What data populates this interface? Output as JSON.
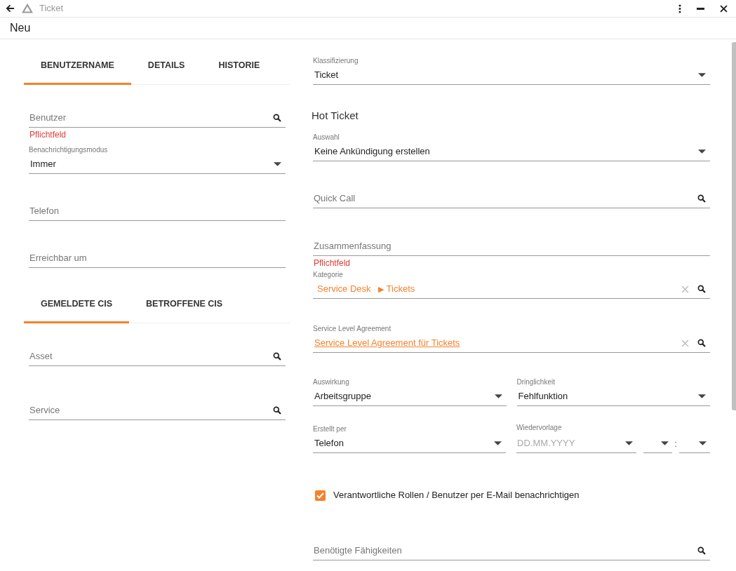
{
  "app_bar": {
    "title": "Ticket"
  },
  "page_title": "Neu",
  "left": [
    {
      "kind": "tabs",
      "tabs": [
        {
          "label": "BENUTZERNAME",
          "selected": true
        },
        {
          "label": "DETAILS",
          "selected": false
        },
        {
          "label": "HISTORIE",
          "selected": false
        }
      ]
    },
    {
      "kind": "search",
      "placeholder": "Benutzer",
      "error": "Pflichtfeld"
    },
    {
      "kind": "select",
      "label": "Benachrichtigungsmodus",
      "value": "Immer"
    },
    {
      "kind": "text",
      "placeholder": "Telefon"
    },
    {
      "kind": "text",
      "placeholder": "Erreichbar um"
    },
    {
      "kind": "tabs",
      "tabs": [
        {
          "label": "GEMELDETE CIS",
          "selected": true
        },
        {
          "label": "BETROFFENE CIS",
          "selected": false
        }
      ]
    },
    {
      "kind": "search",
      "placeholder": "Asset"
    },
    {
      "kind": "search",
      "placeholder": "Service"
    }
  ],
  "right": [
    {
      "kind": "select",
      "label": "Klassifizierung",
      "value": "Ticket"
    },
    {
      "kind": "heading",
      "text": "Hot Ticket"
    },
    {
      "kind": "select",
      "label": "Auswahl",
      "value": "Keine Ankündigung erstellen"
    },
    {
      "kind": "search",
      "placeholder": "Quick Call"
    },
    {
      "kind": "text",
      "placeholder": "Zusammenfassung",
      "error": "Pflichtfeld"
    },
    {
      "kind": "search",
      "label": "Kategorie",
      "path": [
        "Service Desk",
        "Tickets"
      ],
      "separator": "▶",
      "clearable": true
    },
    {
      "kind": "search",
      "label": "Service Level Agreement",
      "link": "Service Level Agreement für Tickets",
      "clearable": true
    },
    {
      "kind": "pair",
      "fields": [
        {
          "kind": "select",
          "label": "Auswirkung",
          "value": "Arbeitsgruppe"
        },
        {
          "kind": "select",
          "label": "Dringlichkeit",
          "value": "Fehlfunktion"
        }
      ]
    },
    {
      "kind": "datetime_row",
      "field": {
        "kind": "select",
        "label": "Erstellt per",
        "value": "Telefon"
      },
      "date": {
        "label": "Wiedervorlage",
        "placeholder": "DD.MM.YYYY",
        "separator": ":"
      }
    },
    {
      "kind": "checkbox",
      "label": "Verantwortliche Rollen / Benutzer per E-Mail benachrichtigen",
      "checked": true
    },
    {
      "kind": "search",
      "placeholder": "Benötigte Fähigkeiten"
    }
  ]
}
